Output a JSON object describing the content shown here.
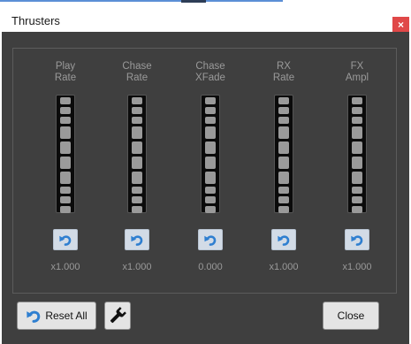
{
  "window": {
    "title": "Thrusters",
    "close_glyph": "×"
  },
  "thrusters": [
    {
      "label_line1": "Play",
      "label_line2": "Rate",
      "value": "x1.000",
      "level": 0.5
    },
    {
      "label_line1": "Chase",
      "label_line2": "Rate",
      "value": "x1.000",
      "level": 0.5
    },
    {
      "label_line1": "Chase",
      "label_line2": "XFade",
      "value": "0.000",
      "level": 0.5
    },
    {
      "label_line1": "RX",
      "label_line2": "Rate",
      "value": "x1.000",
      "level": 0.5
    },
    {
      "label_line1": "FX",
      "label_line2": "Ampl",
      "value": "x1.000",
      "level": 0.5
    }
  ],
  "footer": {
    "reset_all_label": "Reset All",
    "close_label": "Close"
  },
  "icons": {
    "reset": "undo-arrow-icon",
    "wrench": "wrench-icon"
  },
  "colors": {
    "background": "#3f3f3f",
    "accent": "#2f7fd0",
    "close_red": "#e04848"
  }
}
